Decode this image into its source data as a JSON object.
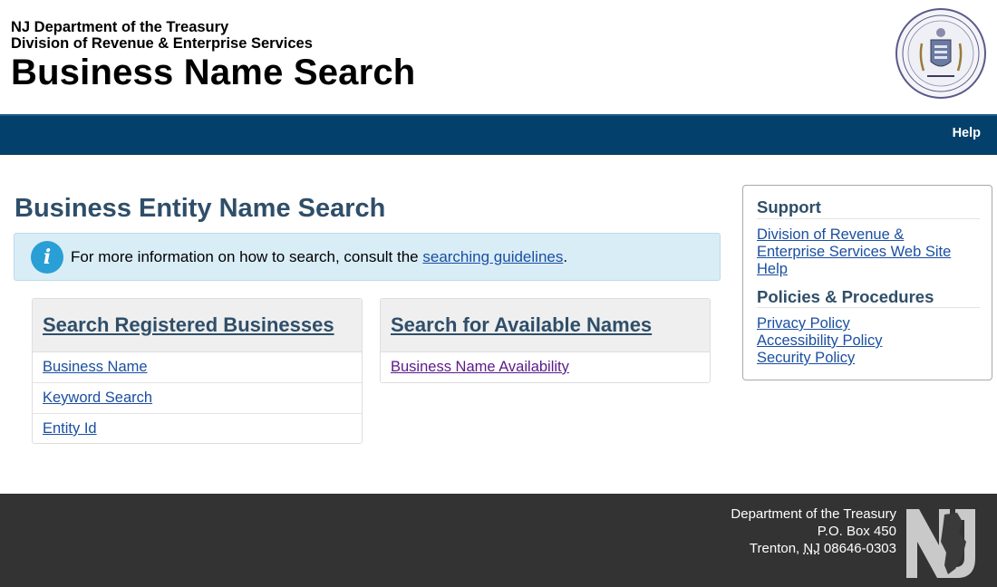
{
  "header": {
    "agency": "NJ Department of the Treasury",
    "division": "Division of Revenue & Enterprise Services",
    "app_title": "Business Name Search",
    "seal_icon": "state-seal-icon"
  },
  "navbar": {
    "help_label": "Help",
    "bg_color": "#03406b"
  },
  "main": {
    "page_title": "Business Entity Name Search",
    "info": {
      "text_before": "For more information on how to search, consult the ",
      "link_text": "searching guidelines",
      "text_after": ".",
      "icon": "info-icon"
    },
    "panels": [
      {
        "title": "Search Registered Businesses",
        "links": [
          "Business Name",
          "Keyword Search",
          "Entity Id"
        ]
      },
      {
        "title": "Search for Available Names",
        "links": [
          "Business Name Availability"
        ]
      }
    ]
  },
  "support": {
    "heading": "Support",
    "links": [
      "Division of Revenue &",
      "Enterprise Services Web Site",
      "Help"
    ],
    "policies_heading": "Policies & Procedures",
    "policy_links": [
      "Privacy Policy",
      "Accessibility Policy",
      "Security Policy"
    ]
  },
  "footer": {
    "line1": "Department of the Treasury",
    "line2": "P.O. Box 450",
    "line3_city": "Trenton, ",
    "line3_state": "NJ",
    "line3_zip": " 08646-0303",
    "logo_icon": "nj-state-logo-icon"
  },
  "colors": {
    "heading": "#2f4e69",
    "link": "#1a4fa0",
    "visited_link": "#5b1a8a",
    "info_bg": "#d9edf7",
    "footer_bg": "#333333"
  }
}
